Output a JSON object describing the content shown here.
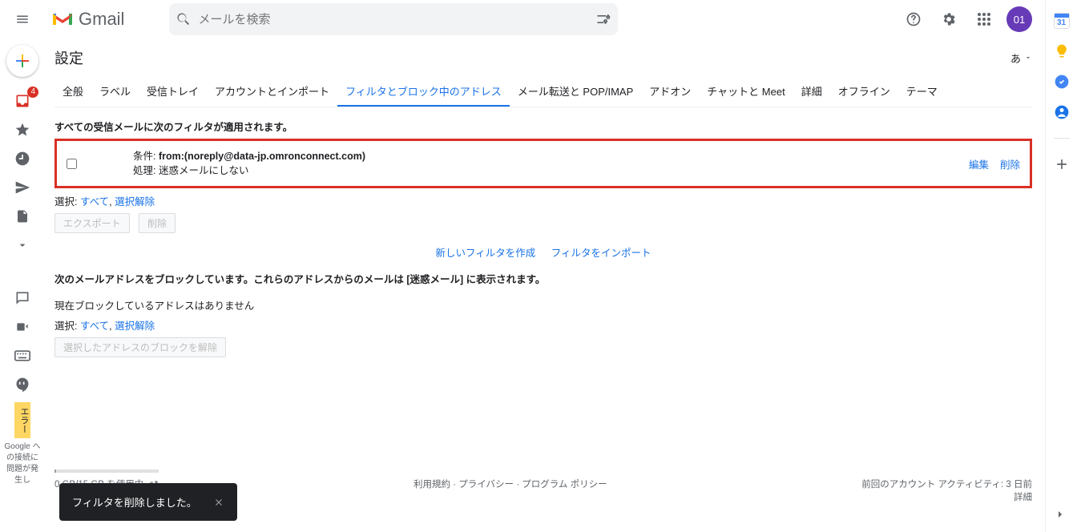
{
  "header": {
    "logo_text": "Gmail",
    "search_placeholder": "メールを検索",
    "avatar_initials": "01"
  },
  "sidebar": {
    "inbox_badge": "4",
    "error_label": "エラー",
    "google_text": "Google への接続に問題が発生し"
  },
  "page": {
    "title": "設定",
    "lang_label": "あ"
  },
  "tabs": [
    "全般",
    "ラベル",
    "受信トレイ",
    "アカウントとインポート",
    "フィルタとブロック中のアドレス",
    "メール転送と POP/IMAP",
    "アドオン",
    "チャットと Meet",
    "詳細",
    "オフライン",
    "テーマ"
  ],
  "tabs_active_index": 4,
  "filters": {
    "intro": "すべての受信メールに次のフィルタが適用されます。",
    "item": {
      "criteria_label": "条件:",
      "criteria_value": "from:(noreply@data-jp.omronconnect.com)",
      "action_label": "処理:",
      "action_value": "迷惑メールにしない",
      "edit": "編集",
      "delete": "削除"
    },
    "select_label": "選択:",
    "select_all": "すべて",
    "select_none": "選択解除",
    "export_btn": "エクスポート",
    "delete_btn": "削除",
    "create_link": "新しいフィルタを作成",
    "import_link": "フィルタをインポート"
  },
  "blocked": {
    "intro": "次のメールアドレスをブロックしています。これらのアドレスからのメールは [迷惑メール] に表示されます。",
    "empty": "現在ブロックしているアドレスはありません",
    "select_label": "選択:",
    "select_all": "すべて",
    "select_none": "選択解除",
    "unblock_btn": "選択したアドレスのブロックを解除"
  },
  "footer": {
    "storage": "0 GB/15 GB を使用中",
    "terms": "利用規約",
    "privacy": "プライバシー",
    "program": "プログラム ポリシー",
    "activity": "前回のアカウント アクティビティ: 3 日前",
    "details": "詳細"
  },
  "toast": {
    "msg": "フィルタを削除しました。"
  }
}
